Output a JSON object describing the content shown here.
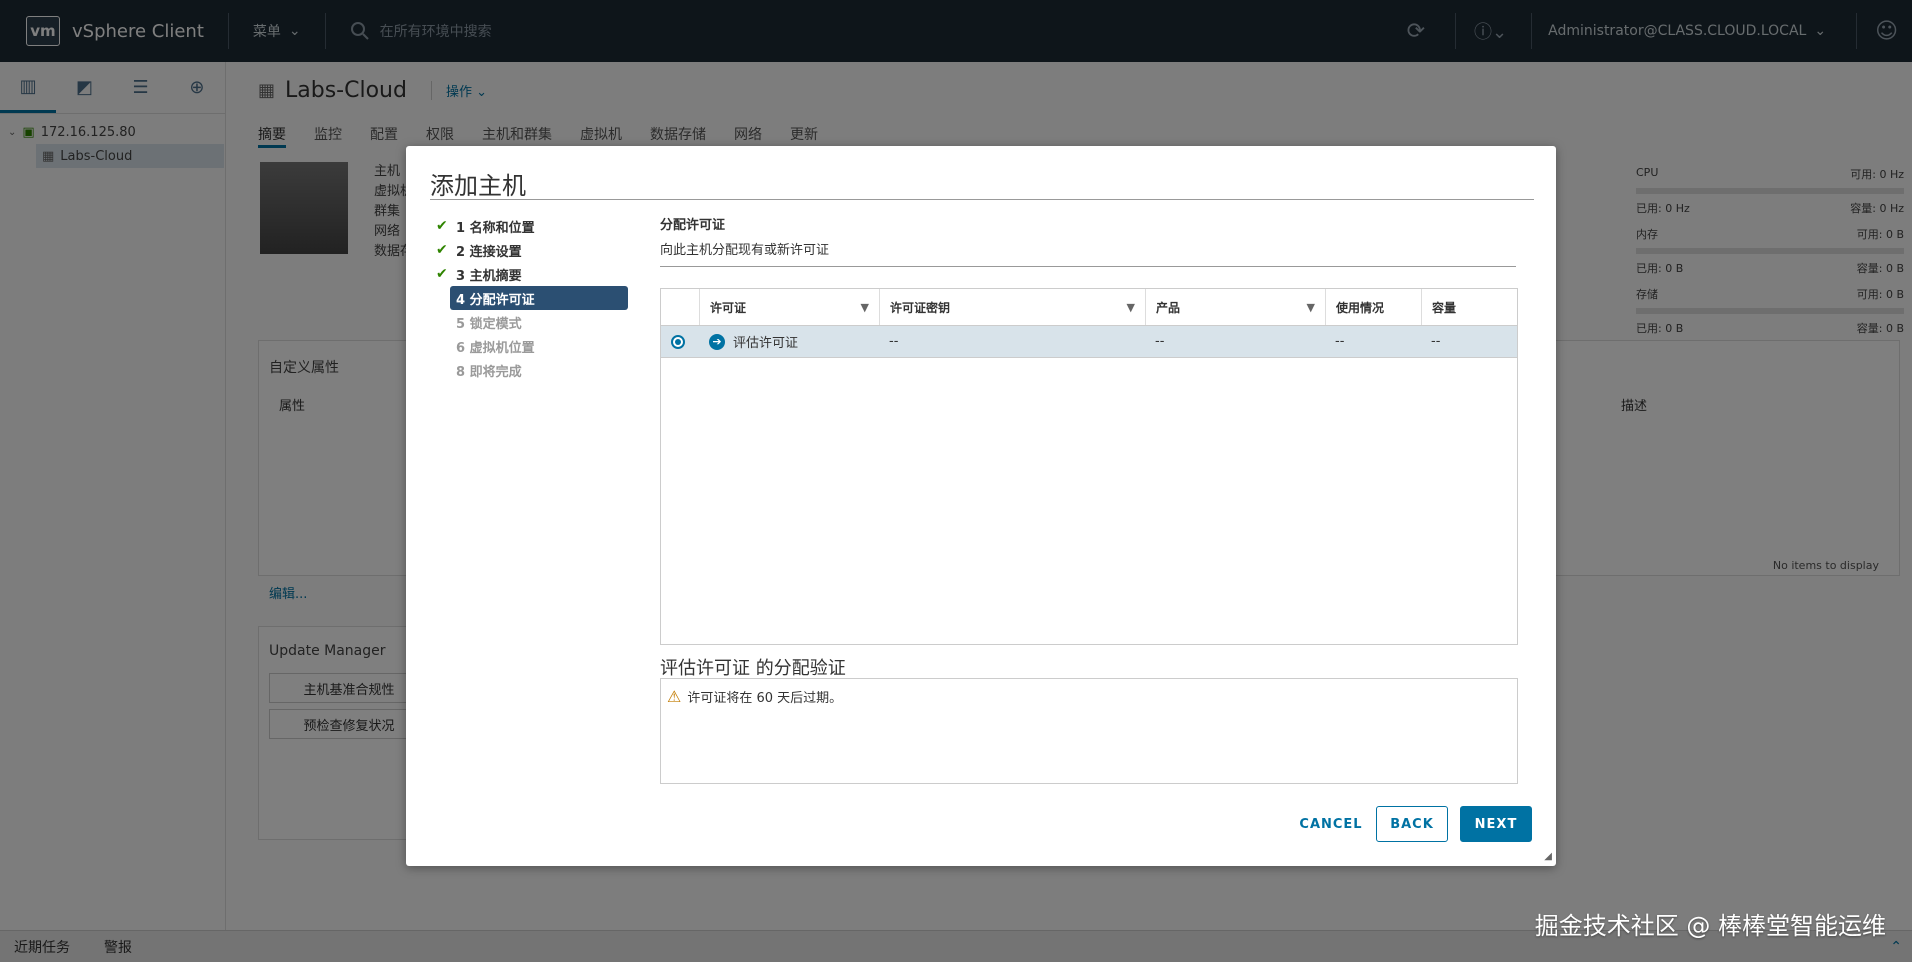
{
  "header": {
    "logo": "vm",
    "app_title": "vSphere Client",
    "menu_label": "菜单",
    "search_placeholder": "在所有环境中搜索",
    "user": "Administrator@CLASS.CLOUD.LOCAL"
  },
  "sidebar": {
    "tree": [
      {
        "label": "172.16.125.80"
      },
      {
        "label": "Labs-Cloud"
      }
    ]
  },
  "main": {
    "object_title": "Labs-Cloud",
    "actions_label": "操作",
    "tabs": [
      "摘要",
      "监控",
      "配置",
      "权限",
      "主机和群集",
      "虚拟机",
      "数据存储",
      "网络",
      "更新"
    ],
    "summary_labels": [
      "主机",
      "虚拟机",
      "群集",
      "网络",
      "数据存"
    ],
    "resources": [
      {
        "name": "CPU",
        "free": "可用: 0 Hz",
        "used": "已用: 0 Hz",
        "cap": "容量: 0 Hz"
      },
      {
        "name": "内存",
        "free": "可用: 0 B",
        "used": "已用: 0 B",
        "cap": "容量: 0 B"
      },
      {
        "name": "存储",
        "free": "可用: 0 B",
        "used": "已用: 0 B",
        "cap": "容量: 0 B"
      }
    ],
    "custom_attrs": {
      "title": "自定义属性",
      "col_attr": "属性",
      "col_desc": "描述",
      "edit": "编辑...",
      "empty": "No items to display"
    },
    "update_manager": {
      "title": "Update Manager",
      "btn1": "主机基准合规性",
      "btn2": "预检查修复状况"
    }
  },
  "bottombar": {
    "recent_tasks": "近期任务",
    "alarms": "警报"
  },
  "modal": {
    "title": "添加主机",
    "steps": [
      {
        "label": "1 名称和位置",
        "state": "done"
      },
      {
        "label": "2 连接设置",
        "state": "done"
      },
      {
        "label": "3 主机摘要",
        "state": "done"
      },
      {
        "label": "4 分配许可证",
        "state": "active"
      },
      {
        "label": "5 锁定模式",
        "state": "disabled"
      },
      {
        "label": "6 虚拟机位置",
        "state": "disabled"
      },
      {
        "label": "8 即将完成",
        "state": "disabled"
      }
    ],
    "section_title": "分配许可证",
    "section_subtitle": "向此主机分配现有或新许可证",
    "grid": {
      "columns": [
        "许可证",
        "许可证密钥",
        "产品",
        "使用情况",
        "容量"
      ],
      "rows": [
        {
          "license": "评估许可证",
          "key": "--",
          "product": "--",
          "usage": "--",
          "capacity": "--",
          "selected": true
        }
      ]
    },
    "validation_title": "评估许可证 的分配验证",
    "validation_message": "许可证将在 60 天后过期。",
    "buttons": {
      "cancel": "CANCEL",
      "back": "BACK",
      "next": "NEXT"
    }
  },
  "watermark": "掘金技术社区 @ 棒棒堂智能运维",
  "colors": {
    "accent": "#0072a3",
    "header_bg": "#1d2a35",
    "active_step": "#2b4f72",
    "selected_row": "#d8e3ea",
    "check": "#2f8400"
  }
}
